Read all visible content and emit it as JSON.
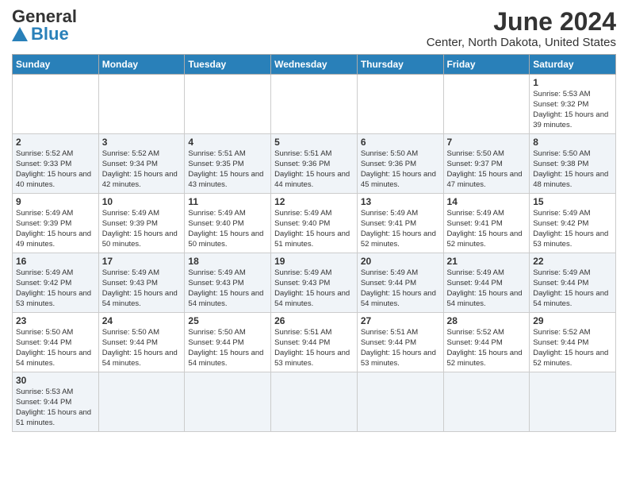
{
  "header": {
    "logo_general": "General",
    "logo_blue": "Blue",
    "month_year": "June 2024",
    "location": "Center, North Dakota, United States"
  },
  "days_of_week": [
    "Sunday",
    "Monday",
    "Tuesday",
    "Wednesday",
    "Thursday",
    "Friday",
    "Saturday"
  ],
  "weeks": [
    [
      {
        "day": "",
        "info": ""
      },
      {
        "day": "",
        "info": ""
      },
      {
        "day": "",
        "info": ""
      },
      {
        "day": "",
        "info": ""
      },
      {
        "day": "",
        "info": ""
      },
      {
        "day": "",
        "info": ""
      },
      {
        "day": "1",
        "info": "Sunrise: 5:53 AM\nSunset: 9:32 PM\nDaylight: 15 hours and 39 minutes."
      }
    ],
    [
      {
        "day": "2",
        "info": "Sunrise: 5:52 AM\nSunset: 9:33 PM\nDaylight: 15 hours and 40 minutes."
      },
      {
        "day": "3",
        "info": "Sunrise: 5:52 AM\nSunset: 9:34 PM\nDaylight: 15 hours and 42 minutes."
      },
      {
        "day": "4",
        "info": "Sunrise: 5:51 AM\nSunset: 9:35 PM\nDaylight: 15 hours and 43 minutes."
      },
      {
        "day": "5",
        "info": "Sunrise: 5:51 AM\nSunset: 9:36 PM\nDaylight: 15 hours and 44 minutes."
      },
      {
        "day": "6",
        "info": "Sunrise: 5:50 AM\nSunset: 9:36 PM\nDaylight: 15 hours and 45 minutes."
      },
      {
        "day": "7",
        "info": "Sunrise: 5:50 AM\nSunset: 9:37 PM\nDaylight: 15 hours and 47 minutes."
      },
      {
        "day": "8",
        "info": "Sunrise: 5:50 AM\nSunset: 9:38 PM\nDaylight: 15 hours and 48 minutes."
      }
    ],
    [
      {
        "day": "9",
        "info": "Sunrise: 5:49 AM\nSunset: 9:39 PM\nDaylight: 15 hours and 49 minutes."
      },
      {
        "day": "10",
        "info": "Sunrise: 5:49 AM\nSunset: 9:39 PM\nDaylight: 15 hours and 50 minutes."
      },
      {
        "day": "11",
        "info": "Sunrise: 5:49 AM\nSunset: 9:40 PM\nDaylight: 15 hours and 50 minutes."
      },
      {
        "day": "12",
        "info": "Sunrise: 5:49 AM\nSunset: 9:40 PM\nDaylight: 15 hours and 51 minutes."
      },
      {
        "day": "13",
        "info": "Sunrise: 5:49 AM\nSunset: 9:41 PM\nDaylight: 15 hours and 52 minutes."
      },
      {
        "day": "14",
        "info": "Sunrise: 5:49 AM\nSunset: 9:41 PM\nDaylight: 15 hours and 52 minutes."
      },
      {
        "day": "15",
        "info": "Sunrise: 5:49 AM\nSunset: 9:42 PM\nDaylight: 15 hours and 53 minutes."
      }
    ],
    [
      {
        "day": "16",
        "info": "Sunrise: 5:49 AM\nSunset: 9:42 PM\nDaylight: 15 hours and 53 minutes."
      },
      {
        "day": "17",
        "info": "Sunrise: 5:49 AM\nSunset: 9:43 PM\nDaylight: 15 hours and 54 minutes."
      },
      {
        "day": "18",
        "info": "Sunrise: 5:49 AM\nSunset: 9:43 PM\nDaylight: 15 hours and 54 minutes."
      },
      {
        "day": "19",
        "info": "Sunrise: 5:49 AM\nSunset: 9:43 PM\nDaylight: 15 hours and 54 minutes."
      },
      {
        "day": "20",
        "info": "Sunrise: 5:49 AM\nSunset: 9:44 PM\nDaylight: 15 hours and 54 minutes."
      },
      {
        "day": "21",
        "info": "Sunrise: 5:49 AM\nSunset: 9:44 PM\nDaylight: 15 hours and 54 minutes."
      },
      {
        "day": "22",
        "info": "Sunrise: 5:49 AM\nSunset: 9:44 PM\nDaylight: 15 hours and 54 minutes."
      }
    ],
    [
      {
        "day": "23",
        "info": "Sunrise: 5:50 AM\nSunset: 9:44 PM\nDaylight: 15 hours and 54 minutes."
      },
      {
        "day": "24",
        "info": "Sunrise: 5:50 AM\nSunset: 9:44 PM\nDaylight: 15 hours and 54 minutes."
      },
      {
        "day": "25",
        "info": "Sunrise: 5:50 AM\nSunset: 9:44 PM\nDaylight: 15 hours and 54 minutes."
      },
      {
        "day": "26",
        "info": "Sunrise: 5:51 AM\nSunset: 9:44 PM\nDaylight: 15 hours and 53 minutes."
      },
      {
        "day": "27",
        "info": "Sunrise: 5:51 AM\nSunset: 9:44 PM\nDaylight: 15 hours and 53 minutes."
      },
      {
        "day": "28",
        "info": "Sunrise: 5:52 AM\nSunset: 9:44 PM\nDaylight: 15 hours and 52 minutes."
      },
      {
        "day": "29",
        "info": "Sunrise: 5:52 AM\nSunset: 9:44 PM\nDaylight: 15 hours and 52 minutes."
      }
    ],
    [
      {
        "day": "30",
        "info": "Sunrise: 5:53 AM\nSunset: 9:44 PM\nDaylight: 15 hours and 51 minutes."
      },
      {
        "day": "",
        "info": ""
      },
      {
        "day": "",
        "info": ""
      },
      {
        "day": "",
        "info": ""
      },
      {
        "day": "",
        "info": ""
      },
      {
        "day": "",
        "info": ""
      },
      {
        "day": "",
        "info": ""
      }
    ]
  ]
}
